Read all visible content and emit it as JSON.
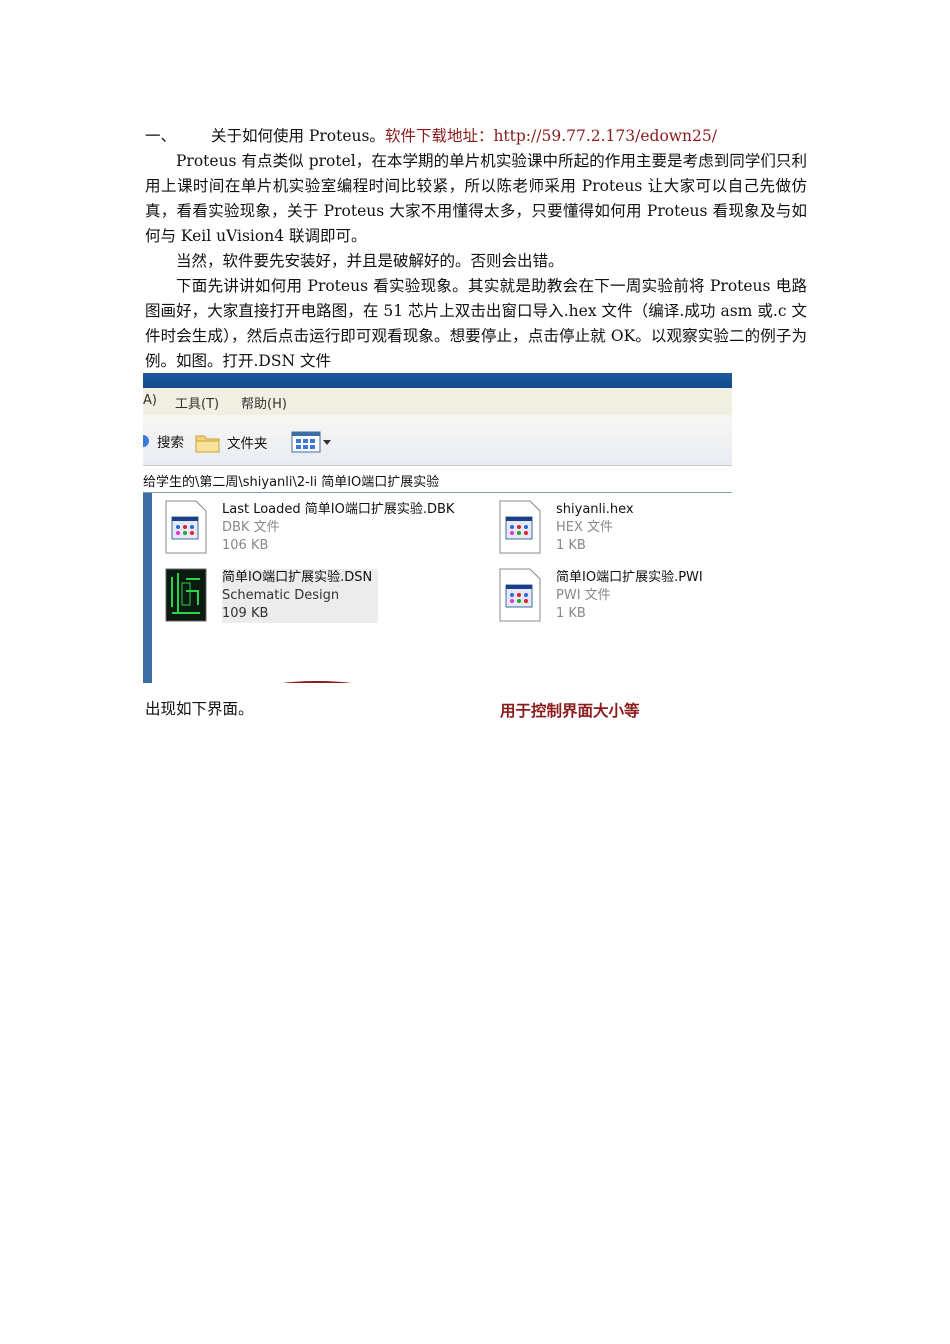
{
  "heading": {
    "number": "一、",
    "title": "关于如何使用 Proteus。",
    "download_label": "软件下载地址：http://59.77.2.173/edown25/"
  },
  "paragraphs": [
    "Proteus 有点类似 protel，在本学期的单片机实验课中所起的作用主要是考虑到同学们只利用上课时间在单片机实验室编程时间比较紧，所以陈老师采用 Proteus 让大家可以自己先做仿真，看看实验现象，关于 Proteus 大家不用懂得太多，只要懂得如何用 Proteus 看现象及与如何与 Keil uVision4 联调即可。",
    "当然，软件要先安装好，并且是破解好的。否则会出错。",
    "下面先讲讲如何用 Proteus 看实验现象。其实就是助教会在下一周实验前将 Proteus 电路图画好，大家直接打开电路图，在 51 芯片上双击出窗口导入.hex 文件（编译.成功 asm 或.c 文件时会生成），然后点击运行即可观看现象。想要停止，点击停止就 OK。以观察实验二的例子为例。如图。打开.DSN 文件"
  ],
  "explorer": {
    "menu": [
      "A)",
      "工具(T)",
      "帮助(H)"
    ],
    "toolbar": {
      "search": "搜索",
      "folders": "文件夹"
    },
    "address": "给学生的\\第二周\\shiyanli\\2-li 简单IO端口扩展实验",
    "files": [
      {
        "name": "Last Loaded 简单IO端口扩展实验.DBK",
        "type": "DBK 文件",
        "size": "106 KB"
      },
      {
        "name": "shiyanli.hex",
        "type": "HEX 文件",
        "size": "1 KB"
      },
      {
        "name": "简单IO端口扩展实验.DSN",
        "type": "Schematic Design",
        "size": "109 KB"
      },
      {
        "name": "简单IO端口扩展实验.PWI",
        "type": "PWI 文件",
        "size": "1 KB"
      }
    ]
  },
  "caption_left": "出现如下界面。",
  "caption_right": "用于控制界面大小等",
  "colors": {
    "accent_red": "#8b1a1a",
    "titlebar_blue": "#0f4a8e"
  }
}
